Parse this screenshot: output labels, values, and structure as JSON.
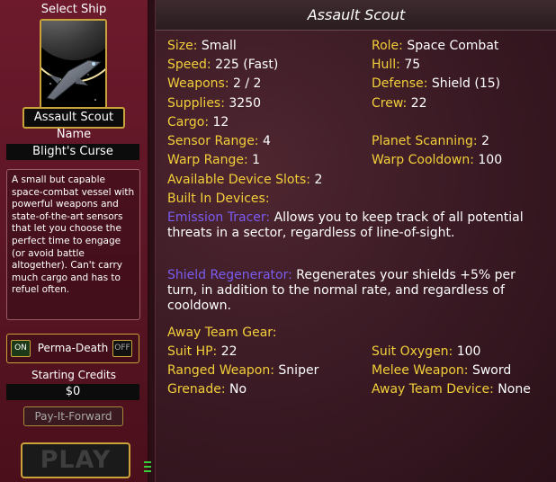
{
  "left_panel": {
    "select_ship_label": "Select Ship",
    "ship_name": "Assault Scout",
    "name_label": "Name",
    "captain_name": "Blight's Curse",
    "description": "A small but capable space-combat vessel with powerful weapons and state-of-the-art sensors that let you choose the perfect time to engage (or avoid battle altogether). Can't carry much cargo and has to refuel often.",
    "perma_death": {
      "on_label": "ON",
      "label": "Perma-Death",
      "off_label": "OFF",
      "state": "on"
    },
    "starting_credits_label": "Starting Credits",
    "starting_credits_value": "$0",
    "pay_it_forward_label": "Pay-It-Forward",
    "play_label": "PLAY"
  },
  "ship_info": {
    "title": "Assault Scout",
    "stats": {
      "size": {
        "key": "Size:",
        "value": "Small"
      },
      "role": {
        "key": "Role:",
        "value": "Space Combat"
      },
      "speed": {
        "key": "Speed:",
        "value": "225 (Fast)"
      },
      "hull": {
        "key": "Hull:",
        "value": "75"
      },
      "weapons": {
        "key": "Weapons:",
        "value": "2 / 2"
      },
      "defense": {
        "key": "Defense:",
        "value": "Shield (15)"
      },
      "supplies": {
        "key": "Supplies:",
        "value": "3250"
      },
      "crew": {
        "key": "Crew:",
        "value": "22"
      },
      "cargo": {
        "key": "Cargo:",
        "value": "12"
      },
      "sensor_range": {
        "key": "Sensor Range:",
        "value": "4"
      },
      "planet_scanning": {
        "key": "Planet Scanning:",
        "value": "2"
      },
      "warp_range": {
        "key": "Warp Range:",
        "value": "1"
      },
      "warp_cooldown": {
        "key": "Warp Cooldown:",
        "value": "100"
      },
      "device_slots": {
        "key": "Available Device Slots:",
        "value": "2"
      }
    },
    "built_in_devices_label": "Built In Devices:",
    "devices": [
      {
        "name": "Emission Tracer:",
        "text": "Allows you to keep track of all potential threats in a sector, regardless of line-of-sight."
      },
      {
        "name": "Shield Regenerator:",
        "text": "Regenerates your shields +5% per turn, in addition to the normal rate, and regardless of cooldown."
      }
    ],
    "away_team": {
      "label": "Away Team Gear:",
      "suit_hp": {
        "key": "Suit HP:",
        "value": "22"
      },
      "suit_oxygen": {
        "key": "Suit Oxygen:",
        "value": "100"
      },
      "ranged_weapon": {
        "key": "Ranged Weapon:",
        "value": "Sniper"
      },
      "melee_weapon": {
        "key": "Melee Weapon:",
        "value": "Sword"
      },
      "grenade": {
        "key": "Grenade:",
        "value": "No"
      },
      "away_device": {
        "key": "Away Team Device:",
        "value": "None"
      }
    }
  },
  "colors": {
    "key_yellow": "#f2cf3a",
    "device_purple": "#7a5cf2",
    "frame_gold": "#c9a23a",
    "panel_maroon": "#6c1a2c"
  }
}
